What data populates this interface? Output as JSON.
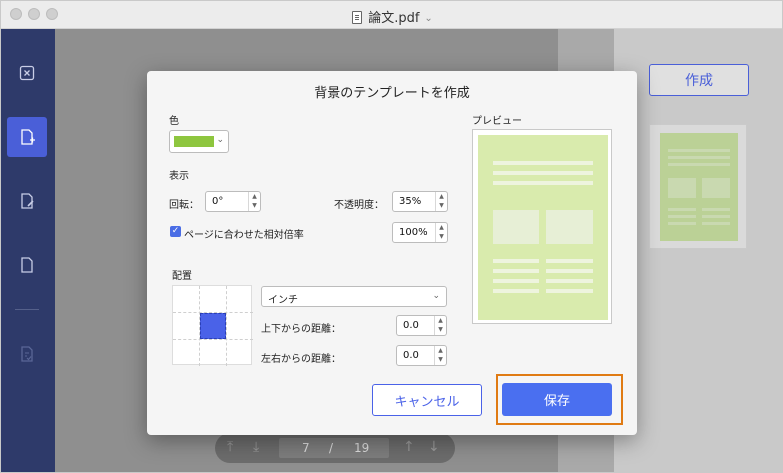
{
  "window": {
    "title": "論文.pdf"
  },
  "sidebar": {
    "items": [
      {
        "name": "close-icon"
      },
      {
        "name": "add-page-icon",
        "active": true
      },
      {
        "name": "edit-page-icon"
      },
      {
        "name": "blank-page-icon"
      },
      {
        "name": "checklist-page-icon"
      }
    ]
  },
  "right_panel": {
    "create_label": "作成"
  },
  "pager": {
    "current": "7",
    "separator": "/",
    "total": "19"
  },
  "dialog": {
    "title": "背景のテンプレートを作成",
    "color": {
      "label": "色",
      "value": "#8ec63f"
    },
    "display": {
      "label": "表示",
      "rotation_label": "回転：",
      "rotation_value": "0°",
      "opacity_label": "不透明度：",
      "opacity_value": "35%",
      "fit_page_label": "ページに合わせた相対倍率",
      "fit_page_checked": true,
      "scale_value": "100%"
    },
    "placement": {
      "label": "配置",
      "unit_value": "インチ",
      "vertical_label": "上下からの距離：",
      "vertical_value": "0.0",
      "horizontal_label": "左右からの距離：",
      "horizontal_value": "0.0"
    },
    "preview": {
      "label": "プレビュー"
    },
    "cancel_label": "キャンセル",
    "save_label": "保存"
  },
  "colors": {
    "accent": "#4a62e8",
    "sidebar": "#2e3a6a",
    "highlight": "#e07b14",
    "preview_bg": "#d9ebad"
  }
}
